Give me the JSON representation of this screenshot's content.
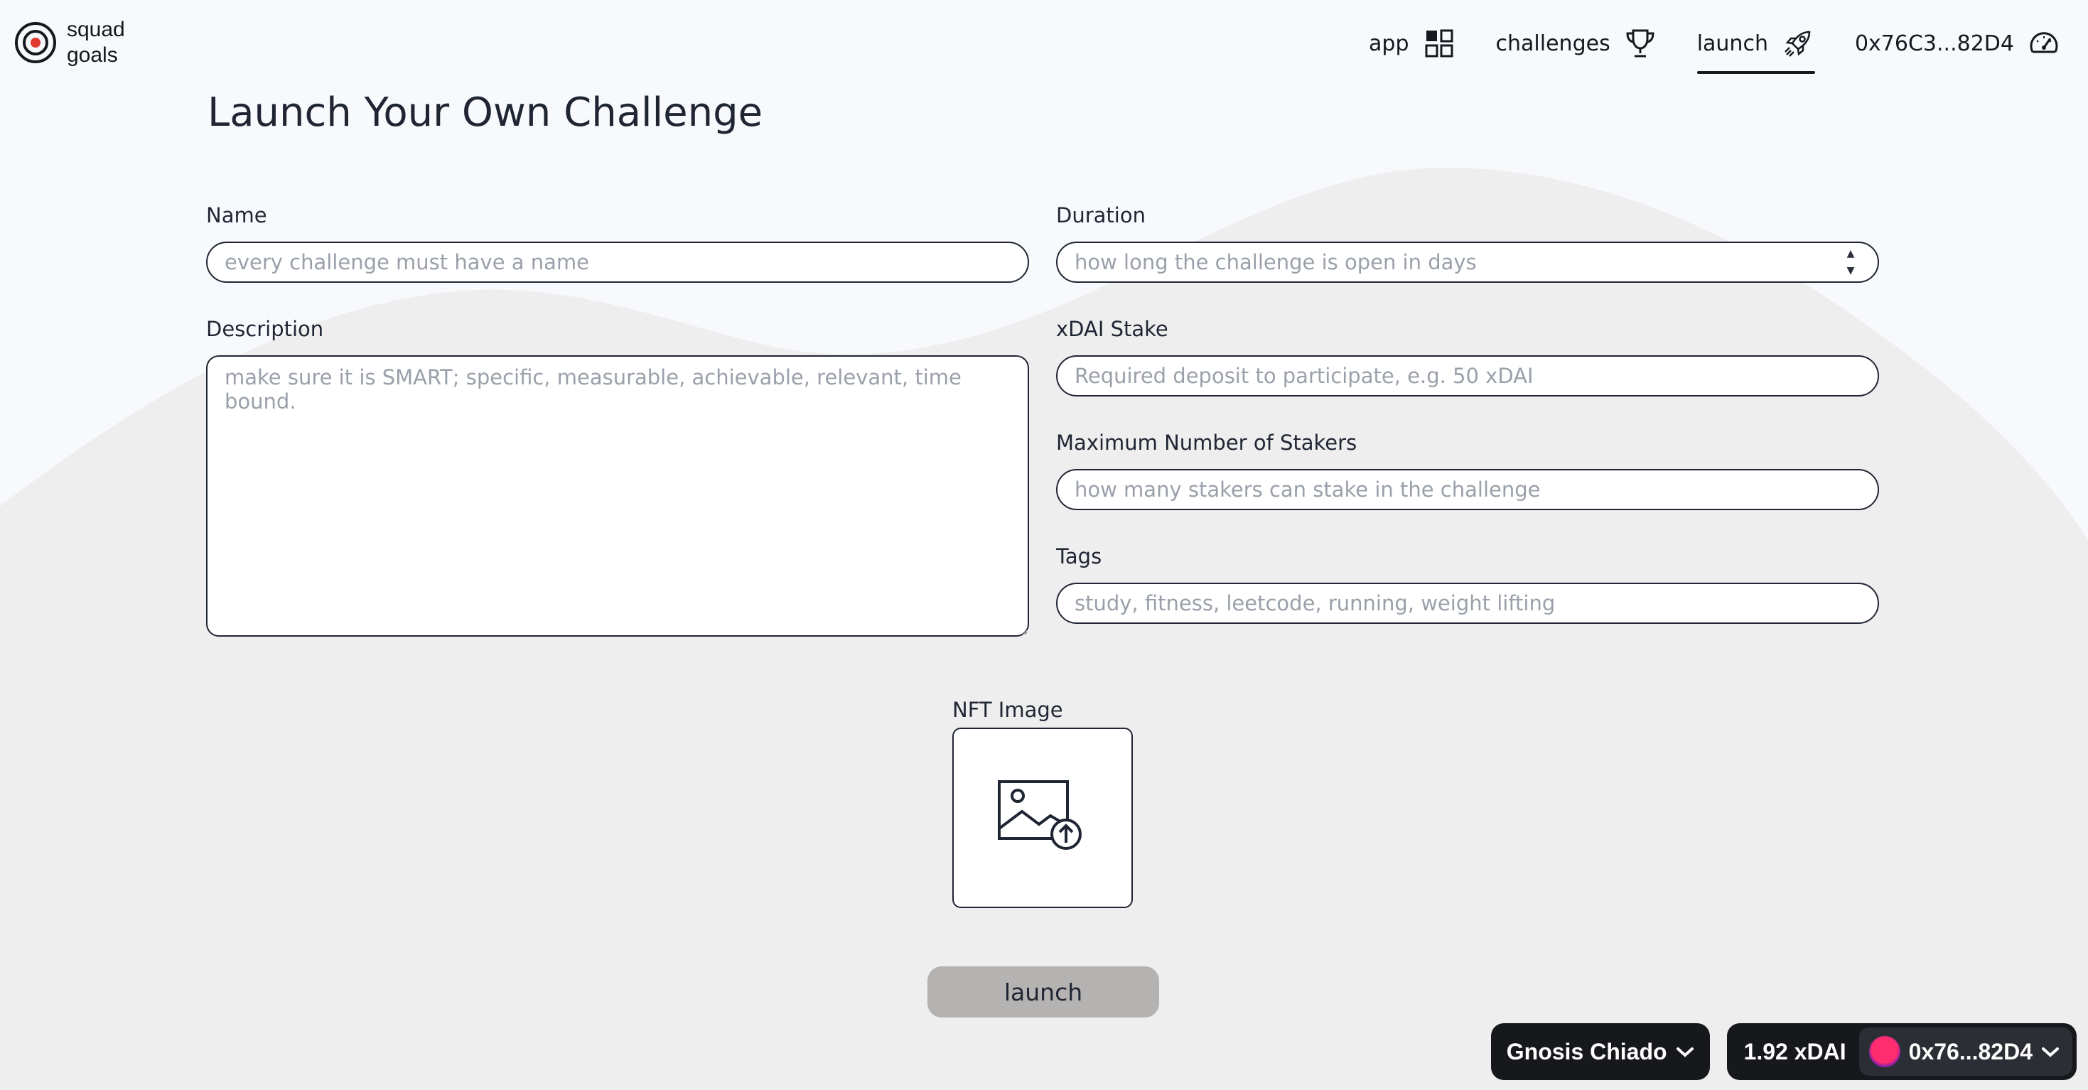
{
  "brand": {
    "line1": "squad",
    "line2": "goals"
  },
  "nav": {
    "items": [
      {
        "label": "app",
        "icon": "grid-icon"
      },
      {
        "label": "challenges",
        "icon": "trophy-icon"
      },
      {
        "label": "launch",
        "icon": "rocket-icon",
        "active": true
      },
      {
        "label": "0x76C3...82D4",
        "icon": "speedometer-icon"
      }
    ]
  },
  "page": {
    "title": "Launch Your Own Challenge"
  },
  "form": {
    "name": {
      "label": "Name",
      "placeholder": "every challenge must have a name"
    },
    "description": {
      "label": "Description",
      "placeholder": "make sure it is SMART; specific, measurable, achievable, relevant, time bound."
    },
    "duration": {
      "label": "Duration",
      "placeholder": "how long the challenge is open in days"
    },
    "stake": {
      "label": "xDAI Stake",
      "placeholder": "Required deposit to participate, e.g. 50 xDAI"
    },
    "max_stakers": {
      "label": "Maximum Number of Stakers",
      "placeholder": "how many stakers can stake in the challenge"
    },
    "tags": {
      "label": "Tags",
      "placeholder": "study, fitness, leetcode, running, weight lifting"
    },
    "nft_image": {
      "label": "NFT Image",
      "icon": "image-upload-icon"
    },
    "submit_label": "launch"
  },
  "wallet": {
    "network": "Gnosis Chiado",
    "balance": "1.92 xDAI",
    "account": "0x76...82D4"
  },
  "colors": {
    "text": "#1f2533",
    "background": "#f7f9fc",
    "wave": "#eeeeee",
    "button": "#b5b3b2",
    "wallet_bg": "#16181c"
  }
}
